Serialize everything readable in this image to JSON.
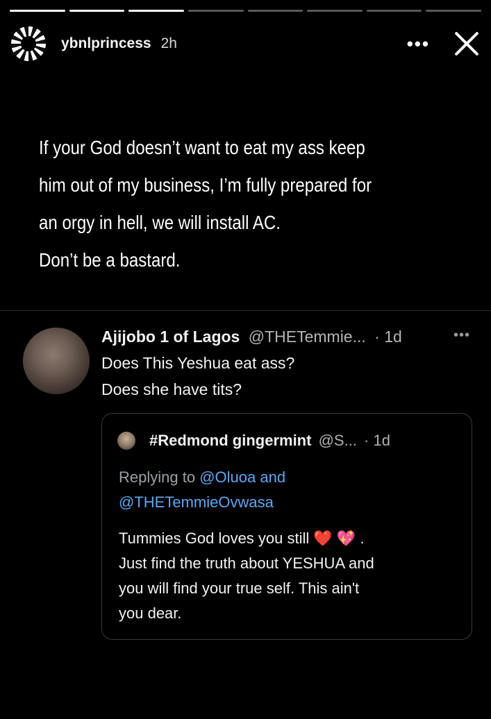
{
  "story": {
    "username": "ybnlprincess",
    "time": "2h",
    "more": "•••",
    "progress_segments": 8,
    "progress_done": 3,
    "text_lines": [
      "If your God doesn’t want to eat my ass keep",
      "him out of my business, I’m fully prepared for",
      "an orgy in hell, we will install AC.",
      "Don’t be a bastard."
    ]
  },
  "tweet": {
    "name": "Ajijobo 1 of Lagos",
    "handle": "@THETemmie...",
    "time": "· 1d",
    "more": "•••",
    "lines": [
      "Does This Yeshua eat ass?",
      "Does she have tits?"
    ]
  },
  "quote": {
    "name": "#Redmond gingermint",
    "handle": "@S...",
    "time": "· 1d",
    "replying_prefix": "Replying to ",
    "mention1": "@Oluoa",
    "and": " and",
    "mention2": "@THETemmieOvwasa",
    "body_line1": "Tummies God loves you still ",
    "heart_red": "❤️",
    "heart_pink": "💖",
    "period": ".",
    "body_line2": "Just find the truth about YESHUA and",
    "body_line3": "you will find your true self. This ain't",
    "body_line4": "you dear."
  }
}
